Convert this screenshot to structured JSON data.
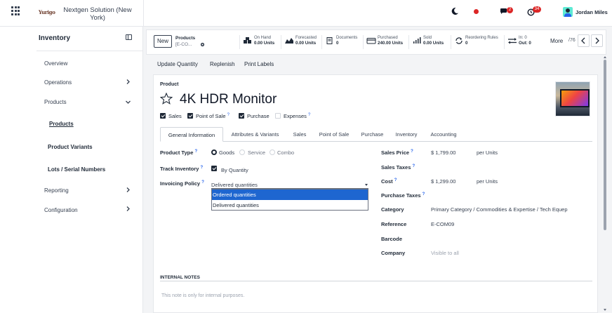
{
  "topbar": {
    "company_logo": "Yurigo",
    "company_name": "Nextgen Solution (New York)",
    "chat_count": "2",
    "activity_count": "34",
    "user_name": "Jordan Miles"
  },
  "sidebar": {
    "title": "Inventory",
    "items": [
      {
        "label": "Overview"
      },
      {
        "label": "Operations"
      },
      {
        "label": "Products"
      },
      {
        "label": "Products"
      },
      {
        "label": "Product Variants"
      },
      {
        "label": "Lots / Serial Numbers"
      },
      {
        "label": "Reporting"
      },
      {
        "label": "Configuration"
      }
    ]
  },
  "control": {
    "new_label": "New",
    "breadcrumb_title": "Products",
    "breadcrumb_sub": "[E-CO...",
    "stats": [
      {
        "l1": "On Hand",
        "l2": "0.00 Units"
      },
      {
        "l1": "Forecasted",
        "l2": "0.00 Units"
      },
      {
        "l1": "Documents",
        "l2": "0"
      },
      {
        "l1": "Purchased",
        "l2": "240.00 Units"
      },
      {
        "l1": "Sold",
        "l2": "0.00 Units"
      },
      {
        "l1": "Reordering Rules",
        "l2": "0"
      },
      {
        "l1": "In: 0",
        "l2": "Out: 0"
      }
    ],
    "more_label": "More",
    "pager": "/76"
  },
  "actions": {
    "update_quantity": "Update Quantity",
    "replenish": "Replenish",
    "print_labels": "Print Labels"
  },
  "form": {
    "product_label": "Product",
    "product_name": "4K HDR Monitor",
    "checkboxes": [
      {
        "label": "Sales",
        "checked": true
      },
      {
        "label": "Point of Sale",
        "checked": true
      },
      {
        "label": "Purchase",
        "checked": true
      },
      {
        "label": "Expenses",
        "checked": false
      }
    ],
    "tabs": [
      {
        "label": "General Information"
      },
      {
        "label": "Attributes & Variants"
      },
      {
        "label": "Sales"
      },
      {
        "label": "Point of Sale"
      },
      {
        "label": "Purchase"
      },
      {
        "label": "Inventory"
      },
      {
        "label": "Accounting"
      }
    ],
    "left": {
      "product_type_label": "Product Type",
      "product_type_options": [
        "Goods",
        "Service",
        "Combo"
      ],
      "track_inventory_label": "Track Inventory",
      "track_inventory_value": "By Quantity",
      "invoicing_policy_label": "Invoicing Policy",
      "invoicing_policy_value": "Delivered quantities",
      "dropdown_options": [
        "Ordered quantities",
        "Delivered quantities"
      ]
    },
    "right": {
      "sales_price_label": "Sales Price",
      "sales_price_value": "$ 1,799.00",
      "sales_price_unit": "per Units",
      "sales_taxes_label": "Sales Taxes",
      "cost_label": "Cost",
      "cost_value": "$ 1,299.00",
      "cost_unit": "per Units",
      "purchase_taxes_label": "Purchase Taxes",
      "category_label": "Category",
      "category_value": "Primary Category / Commodities & Expertise / Tech Equep",
      "reference_label": "Reference",
      "reference_value": "E-COM09",
      "barcode_label": "Barcode",
      "company_label": "Company",
      "company_value": "Visible to all"
    },
    "notes_label": "INTERNAL NOTES",
    "notes_placeholder": "This note is only for internal purposes."
  }
}
